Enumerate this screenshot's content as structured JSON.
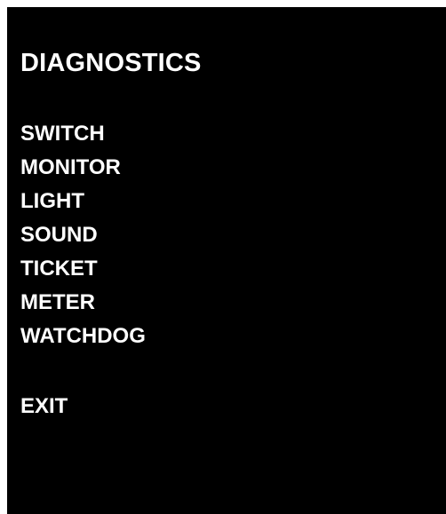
{
  "screen": {
    "title": "DIAGNOSTICS",
    "background_color": "#000000",
    "text_color": "#ffffff"
  },
  "menu": {
    "items": [
      {
        "label": "SWITCH"
      },
      {
        "label": "MONITOR"
      },
      {
        "label": "LIGHT"
      },
      {
        "label": "SOUND"
      },
      {
        "label": "TICKET"
      },
      {
        "label": "METER"
      },
      {
        "label": "WATCHDOG"
      }
    ],
    "exit_label": "EXIT"
  }
}
